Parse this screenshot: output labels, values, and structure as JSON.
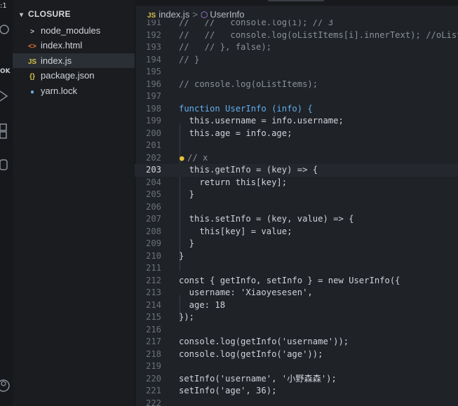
{
  "activity": {
    "badge_top": ":1",
    "badge_ok": "OK"
  },
  "explorer": {
    "title": "CLOSURE",
    "items": [
      {
        "label": "node_modules",
        "icon": ">",
        "icon_color": "#c0c4ca"
      },
      {
        "label": "index.html",
        "icon": "<>",
        "icon_color": "#e37933"
      },
      {
        "label": "index.js",
        "icon": "JS",
        "icon_color": "#d8c14a",
        "active": true
      },
      {
        "label": "package.json",
        "icon": "{}",
        "icon_color": "#d8c14a"
      },
      {
        "label": "yarn.lock",
        "icon": "yarn-icon",
        "icon_color": "#6fa8dc"
      }
    ]
  },
  "breadcrumb": {
    "file_icon": "JS",
    "file": "index.js",
    "separator": ">",
    "symbol_icon": "class-icon",
    "symbol": "UserInfo"
  },
  "editor": {
    "lines": [
      {
        "n": "191",
        "text": "//   //   console.log(i); // 3"
      },
      {
        "n": "192",
        "text": "//   //   console.log(oListItems[i].innerText); //oListI"
      },
      {
        "n": "193",
        "text": "//   // }, false);"
      },
      {
        "n": "194",
        "text": "// }"
      },
      {
        "n": "195",
        "text": ""
      },
      {
        "n": "196",
        "text": "// console.log(oListItems);"
      },
      {
        "n": "197",
        "text": ""
      },
      {
        "n": "198",
        "text": "function UserInfo (info) {"
      },
      {
        "n": "199",
        "text": "  this.username = info.username;"
      },
      {
        "n": "200",
        "text": "  this.age = info.age;"
      },
      {
        "n": "201",
        "text": ""
      },
      {
        "n": "202",
        "text": "// x"
      },
      {
        "n": "203",
        "text": "  this.getInfo = (key) => {"
      },
      {
        "n": "204",
        "text": "    return this[key];"
      },
      {
        "n": "205",
        "text": "  }"
      },
      {
        "n": "206",
        "text": ""
      },
      {
        "n": "207",
        "text": "  this.setInfo = (key, value) => {"
      },
      {
        "n": "208",
        "text": "    this[key] = value;"
      },
      {
        "n": "209",
        "text": "  }"
      },
      {
        "n": "210",
        "text": "}"
      },
      {
        "n": "211",
        "text": ""
      },
      {
        "n": "212",
        "text": "const { getInfo, setInfo } = new UserInfo({"
      },
      {
        "n": "213",
        "text": "  username: 'Xiaoyesesen',"
      },
      {
        "n": "214",
        "text": "  age: 18"
      },
      {
        "n": "215",
        "text": "});"
      },
      {
        "n": "216",
        "text": ""
      },
      {
        "n": "217",
        "text": "console.log(getInfo('username'));"
      },
      {
        "n": "218",
        "text": "console.log(getInfo('age'));"
      },
      {
        "n": "219",
        "text": ""
      },
      {
        "n": "220",
        "text": "setInfo('username', '小野森森');"
      },
      {
        "n": "221",
        "text": "setInfo('age', 36);"
      },
      {
        "n": "222",
        "text": ""
      }
    ],
    "current_line": "203"
  }
}
